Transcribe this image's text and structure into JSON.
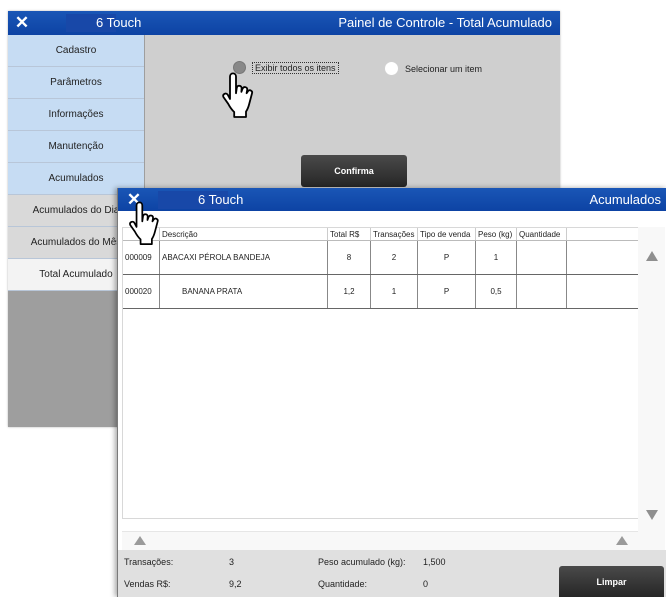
{
  "back_window": {
    "app_name": "6 Touch",
    "panel_title": "Painel de Controle - Total Acumulado",
    "sidebar": [
      {
        "label": "Cadastro"
      },
      {
        "label": "Parâmetros"
      },
      {
        "label": "Informações"
      },
      {
        "label": "Manutenção"
      },
      {
        "label": "Acumulados"
      },
      {
        "label": "Acumulados do Dia"
      },
      {
        "label": "Acumulados do Mês"
      },
      {
        "label": "Total Acumulado"
      }
    ],
    "radio_all": "Exibir todos os itens",
    "radio_one": "Selecionar um item",
    "confirm_label": "Confirma"
  },
  "front_window": {
    "app_name": "6 Touch",
    "title": "Acumulados",
    "columns": [
      "Descrição",
      "Total  R$",
      "Transações",
      "Tipo de venda",
      "Peso (kg)",
      "Quantidade"
    ],
    "rows": [
      {
        "code": "000009",
        "desc": "ABACAXI PÉROLA BANDEJA",
        "total": "8",
        "trans": "2",
        "tipo": "P",
        "peso": "1",
        "qtd": ""
      },
      {
        "code": "000020",
        "desc": "BANANA PRATA",
        "total": "1,2",
        "trans": "1",
        "tipo": "P",
        "peso": "0,5",
        "qtd": ""
      }
    ],
    "footer": {
      "transacoes_label": "Transações:",
      "transacoes_value": "3",
      "vendas_label": "Vendas  R$:",
      "vendas_value": "9,2",
      "peso_label": "Peso acumulado (kg):",
      "peso_value": "1,500",
      "quantidade_label": "Quantidade:",
      "quantidade_value": "0"
    },
    "clear_label": "Limpar"
  },
  "icons": [
    "close-icon",
    "pointer-hand-icon",
    "scroll-up-icon",
    "scroll-down-icon",
    "scroll-left-icon",
    "scroll-right-icon"
  ],
  "colors": {
    "titlebar": "#1a56b6",
    "sidebar_blue": "#c6dcf3",
    "button_dark": "#333333"
  }
}
